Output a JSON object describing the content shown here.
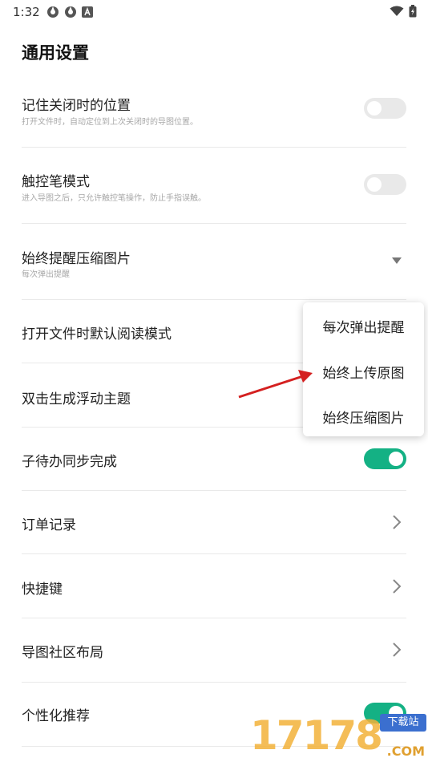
{
  "status_bar": {
    "time": "1:32"
  },
  "page": {
    "title": "通用设置"
  },
  "settings": [
    {
      "id": "remember-position",
      "title": "记住关闭时的位置",
      "subtitle": "打开文件时，自动定位到上次关闭时的导图位置。",
      "control": "toggle",
      "on": false
    },
    {
      "id": "stylus-mode",
      "title": "触控笔模式",
      "subtitle": "进入导图之后，只允许触控笔操作，防止手指误触。",
      "control": "toggle",
      "on": false
    },
    {
      "id": "compress-images",
      "title": "始终提醒压缩图片",
      "subtitle": "每次弹出提醒",
      "control": "dropdown"
    },
    {
      "id": "default-read-mode",
      "title": "打开文件时默认阅读模式"
    },
    {
      "id": "double-tap-floating",
      "title": "双击生成浮动主题"
    },
    {
      "id": "subtask-sync",
      "title": "子待办同步完成",
      "control": "toggle",
      "on": true
    },
    {
      "id": "order-records",
      "title": "订单记录",
      "control": "chevron"
    },
    {
      "id": "shortcuts",
      "title": "快捷键",
      "control": "chevron"
    },
    {
      "id": "community-layout",
      "title": "导图社区布局",
      "control": "chevron"
    },
    {
      "id": "personalized-recommend",
      "title": "个性化推荐",
      "control": "toggle",
      "on": true
    }
  ],
  "dropdown_menu": {
    "options": [
      "每次弹出提醒",
      "始终上传原图",
      "始终压缩图片"
    ]
  },
  "watermark": {
    "digits": "17178",
    "badge": "下载站",
    "domain": ".COM"
  },
  "colors": {
    "accent": "#14b184",
    "divider": "#e9e9e9",
    "subtitle": "#a8a8a8",
    "arrow": "#d42020"
  }
}
